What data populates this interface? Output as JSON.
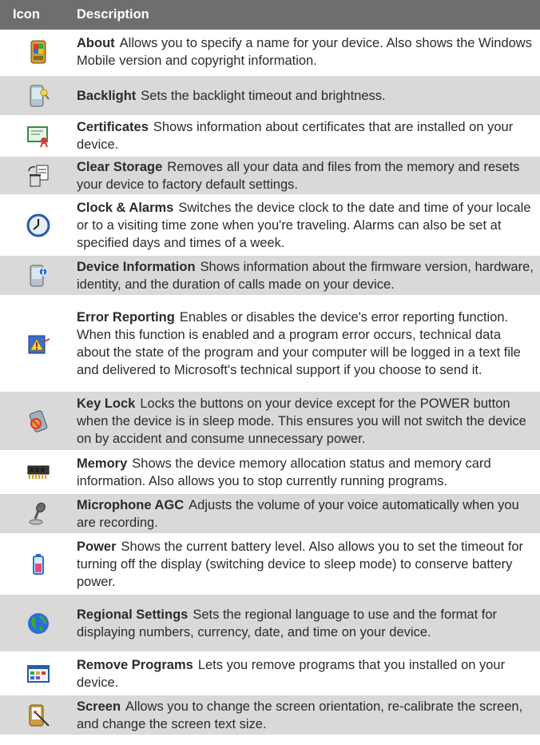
{
  "header": {
    "icon_label": "Icon",
    "description_label": "Description"
  },
  "rows": [
    {
      "title": "About",
      "text": "Allows you to specify a name for your device. Also shows the Windows Mobile version and copyright information.",
      "icon": "about-icon"
    },
    {
      "title": "Backlight",
      "text": "Sets the backlight timeout and brightness.",
      "icon": "backlight-icon"
    },
    {
      "title": "Certificates",
      "text": "Shows information about certificates that are installed on your device.",
      "icon": "certificates-icon"
    },
    {
      "title": "Clear Storage",
      "text": "Removes all your data and files from the memory and resets your device to factory default settings.",
      "icon": "clear-storage-icon"
    },
    {
      "title": "Clock & Alarms",
      "text": "Switches the device clock to the date and time of your locale or to a visiting time zone when you're traveling. Alarms can also be set at specified days and times of a week.",
      "icon": "clock-icon"
    },
    {
      "title": "Device Information",
      "text": "Shows information about the firmware version, hardware, identity, and the duration of calls made on your device.",
      "icon": "device-information-icon"
    },
    {
      "title": "Error Reporting",
      "text": "Enables or disables the device's error reporting function. When this function is enabled and a program error occurs, technical data about the state of the program and your computer will be logged in a text file and delivered to Microsoft's technical support if you choose to send it.",
      "icon": "error-reporting-icon"
    },
    {
      "title": "Key Lock",
      "text": "Locks the buttons on your device except for the POWER button when the device is in sleep mode. This ensures you will not switch the device on by accident and consume unnecessary power.",
      "icon": "key-lock-icon"
    },
    {
      "title": "Memory",
      "text": "Shows the device memory allocation status and memory card information. Also allows you to stop currently running programs.",
      "icon": "memory-icon"
    },
    {
      "title": "Microphone AGC",
      "text": "Adjusts the volume of your voice automatically when you are recording.",
      "icon": "microphone-icon"
    },
    {
      "title": "Power",
      "text": "Shows the current battery level. Also allows you to set the timeout for turning off the display (switching device to sleep mode) to conserve battery power.",
      "icon": "battery-icon"
    },
    {
      "title": "Regional Settings",
      "text": "Sets the regional language to use and the format for displaying numbers, currency, date, and time on your device.",
      "icon": "globe-icon"
    },
    {
      "title": "Remove Programs",
      "text": "Lets you remove programs that you installed on your device.",
      "icon": "remove-programs-icon"
    },
    {
      "title": "Screen",
      "text": "Allows you to change the screen orientation, re-calibrate the screen, and change the screen text size.",
      "icon": "screen-icon"
    }
  ]
}
